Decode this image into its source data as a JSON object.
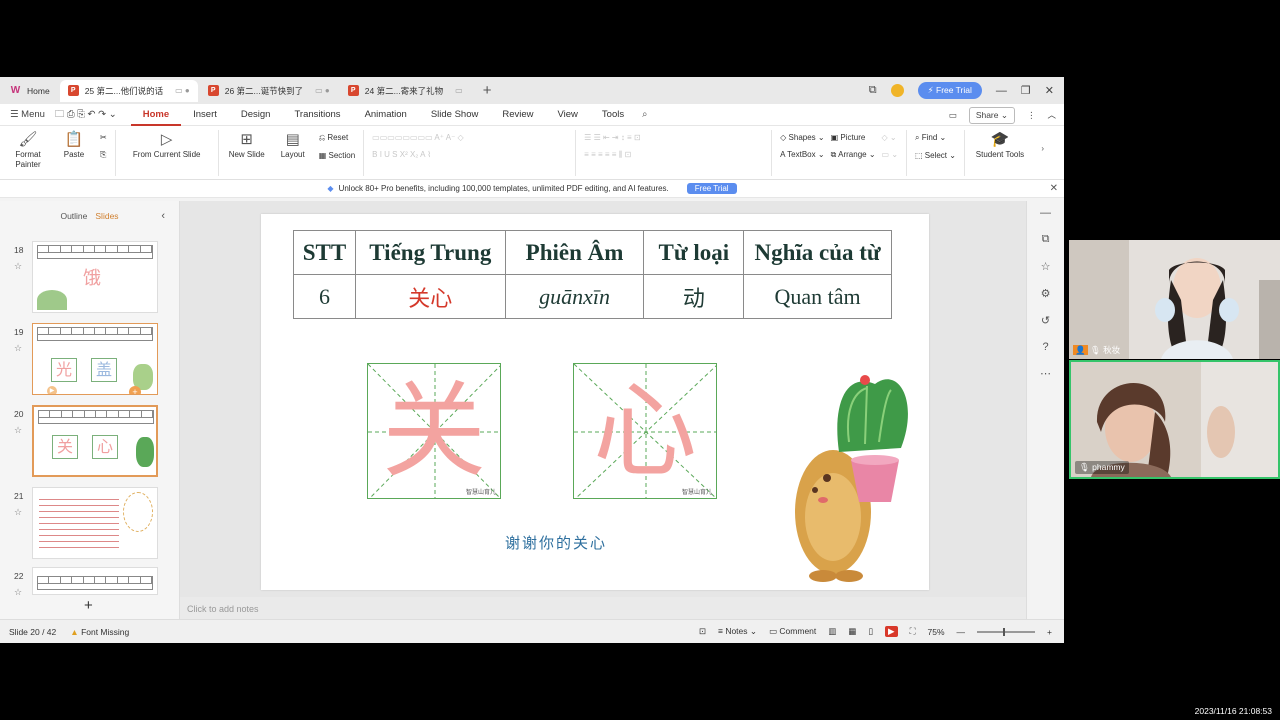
{
  "tabs": {
    "home": "Home",
    "doc1": "25 第二...他们说的话",
    "doc2": "26 第二...诞节快到了",
    "doc3": "24 第二...寄来了礼物",
    "free_trial": "Free Trial"
  },
  "menu": {
    "menu_label": "Menu",
    "items": [
      "Home",
      "Insert",
      "Design",
      "Transitions",
      "Animation",
      "Slide Show",
      "Review",
      "View",
      "Tools"
    ],
    "share": "Share"
  },
  "ribbon": {
    "format_painter": "Format Painter",
    "paste": "Paste",
    "from_current_slide": "From Current Slide",
    "new_slide": "New Slide",
    "layout": "Layout",
    "reset": "Reset",
    "section": "Section",
    "shapes": "Shapes",
    "picture": "Picture",
    "find": "Find",
    "textbox": "TextBox",
    "arrange": "Arrange",
    "select": "Select",
    "student_tools": "Student Tools"
  },
  "infobar": {
    "text": "Unlock 80+ Pro benefits, including 100,000 templates, unlimited PDF editing, and AI features.",
    "button": "Free Trial"
  },
  "left_panel": {
    "outline": "Outline",
    "slides": "Slides",
    "thumbs": [
      {
        "num": "18"
      },
      {
        "num": "19"
      },
      {
        "num": "20"
      },
      {
        "num": "21"
      },
      {
        "num": "22"
      }
    ]
  },
  "slide": {
    "headers": [
      "STT",
      "Tiếng Trung",
      "Phiên Âm",
      "Từ loại",
      "Nghĩa của từ"
    ],
    "row": [
      "6",
      "关心",
      "guānxīn",
      "动",
      "Quan tâm"
    ],
    "char1": "关",
    "char2": "心",
    "grid_mark": "智慧山育儿",
    "thanks": "谢谢你的关心"
  },
  "notes_placeholder": "Click to add notes",
  "status": {
    "slide_count": "Slide 20 / 42",
    "font_missing": "Font Missing",
    "notes": "Notes",
    "comment": "Comment",
    "zoom": "75%"
  },
  "video": {
    "participant1": "秋妆",
    "participant2": "phammy"
  },
  "timestamp": "2023/11/16 21:08:53",
  "colors": {
    "accent_red": "#c8362a",
    "selection_orange": "#e29a58",
    "table_text": "#1f3b35",
    "grid_green": "#5aa858",
    "char_pink": "#f3a3a0",
    "thanks_blue": "#2e6f9e",
    "free_trial_blue": "#5b8def"
  }
}
